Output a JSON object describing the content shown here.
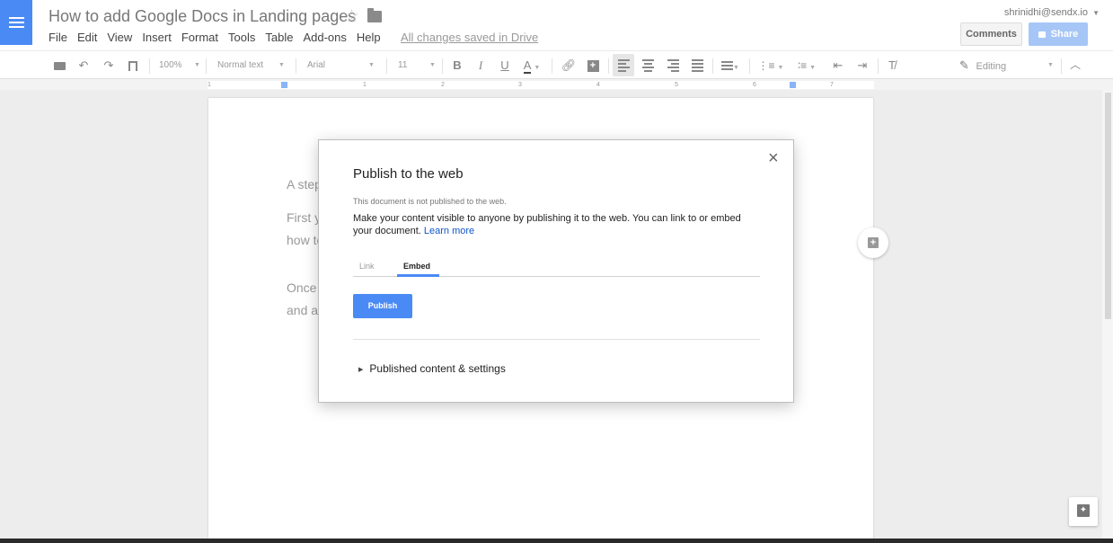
{
  "header": {
    "doc_title": "How to add Google Docs in Landing pages",
    "menu": [
      "File",
      "Edit",
      "View",
      "Insert",
      "Format",
      "Tools",
      "Table",
      "Add-ons",
      "Help"
    ],
    "save_status": "All changes saved in Drive",
    "account_email": "shrinidhi@sendx.io",
    "comments_label": "Comments",
    "share_label": "Share"
  },
  "toolbar": {
    "zoom": "100%",
    "style": "Normal text",
    "font": "Arial",
    "font_size": "11",
    "bold": "B",
    "italic": "I",
    "underline": "U",
    "text_color": "A",
    "mode": "Editing"
  },
  "ruler": {
    "numbers": [
      "1",
      "1",
      "2",
      "3",
      "4",
      "5",
      "6",
      "7"
    ]
  },
  "document": {
    "lines": [
      "A step",
      "First y",
      "how to",
      "Once",
      "and ac"
    ]
  },
  "modal": {
    "title": "Publish to the web",
    "status": "This document is not published to the web.",
    "description": "Make your content visible to anyone by publishing it to the web. You can link to or embed your document.",
    "learn_more": "Learn more",
    "tabs": {
      "link": "Link",
      "embed": "Embed"
    },
    "publish_label": "Publish",
    "settings_label": "Published content & settings",
    "close_glyph": "×"
  },
  "colors": {
    "accent": "#4a8af4",
    "link": "#1155cc",
    "share_disabled": "#a6c6f7"
  }
}
